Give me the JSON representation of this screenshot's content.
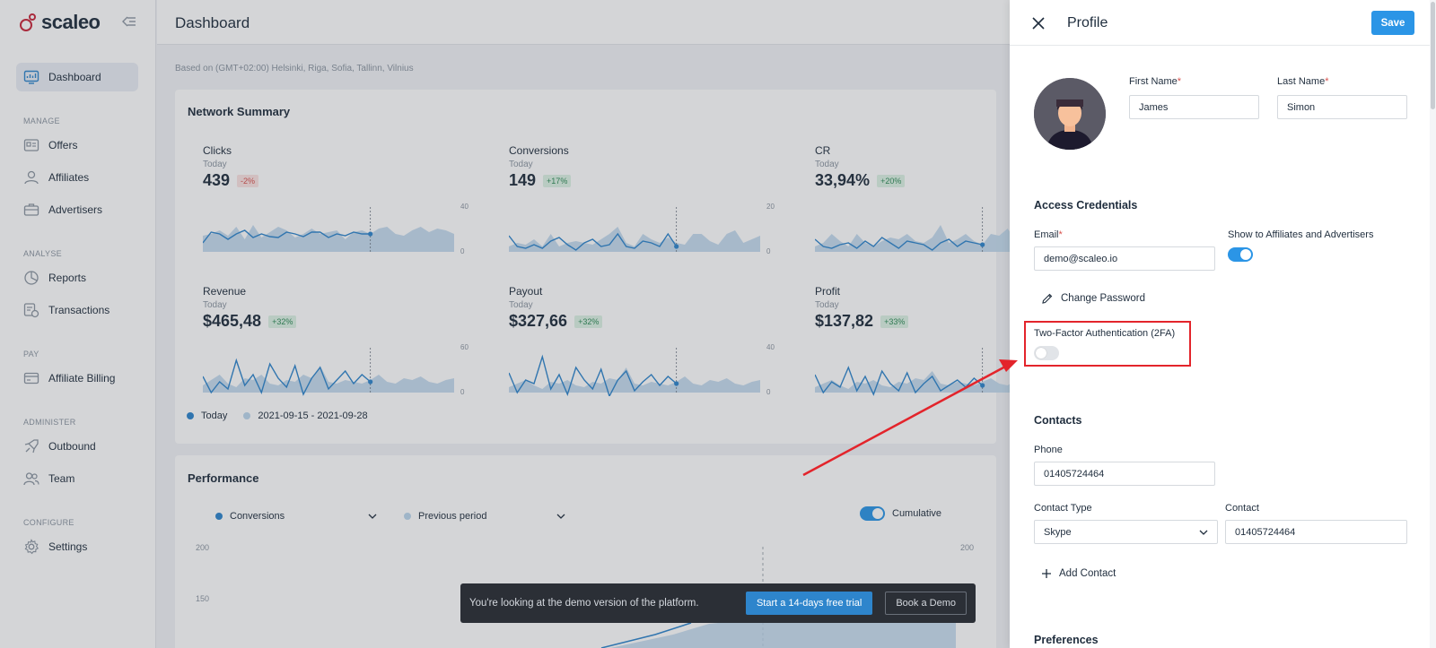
{
  "app": {
    "brand": "scaleo",
    "page_title": "Dashboard",
    "timezone_note": "Based on (GMT+02:00) Helsinki, Riga, Sofia, Tallinn, Vilnius"
  },
  "sidebar": {
    "items": [
      {
        "label": "Dashboard",
        "icon": "dashboard-icon",
        "active": true
      },
      {
        "section": "MANAGE"
      },
      {
        "label": "Offers",
        "icon": "offers-icon"
      },
      {
        "label": "Affiliates",
        "icon": "user-icon"
      },
      {
        "label": "Advertisers",
        "icon": "briefcase-icon"
      },
      {
        "section": "ANALYSE"
      },
      {
        "label": "Reports",
        "icon": "pie-chart-icon"
      },
      {
        "label": "Transactions",
        "icon": "transactions-icon"
      },
      {
        "section": "PAY"
      },
      {
        "label": "Affiliate Billing",
        "icon": "billing-icon"
      },
      {
        "section": "ADMINISTER"
      },
      {
        "label": "Outbound",
        "icon": "rocket-icon"
      },
      {
        "label": "Team",
        "icon": "team-icon"
      },
      {
        "section": "CONFIGURE"
      },
      {
        "label": "Settings",
        "icon": "gear-icon"
      }
    ],
    "labels": {
      "dashboard": "Dashboard",
      "manage": "MANAGE",
      "offers": "Offers",
      "affiliates": "Affiliates",
      "advertisers": "Advertisers",
      "analyse": "ANALYSE",
      "reports": "Reports",
      "transactions": "Transactions",
      "pay": "PAY",
      "billing": "Affiliate Billing",
      "administer": "ADMINISTER",
      "outbound": "Outbound",
      "team": "Team",
      "configure": "CONFIGURE",
      "settings": "Settings"
    }
  },
  "network_summary": {
    "title": "Network Summary",
    "metrics": [
      {
        "label": "Clicks",
        "period": "Today",
        "value": "439",
        "change": "-2%",
        "trend": "neg",
        "axis_max": "40",
        "axis_min": "0"
      },
      {
        "label": "Conversions",
        "period": "Today",
        "value": "149",
        "change": "+17%",
        "trend": "pos",
        "axis_max": "20",
        "axis_min": "0"
      },
      {
        "label": "CR",
        "period": "Today",
        "value": "33,94%",
        "change": "+20%",
        "trend": "pos",
        "axis_max": "",
        "axis_min": ""
      },
      {
        "label": "Revenue",
        "period": "Today",
        "value": "$465,48",
        "change": "+32%",
        "trend": "pos",
        "axis_max": "60",
        "axis_min": "0"
      },
      {
        "label": "Payout",
        "period": "Today",
        "value": "$327,66",
        "change": "+32%",
        "trend": "pos",
        "axis_max": "40",
        "axis_min": "0"
      },
      {
        "label": "Profit",
        "period": "Today",
        "value": "$137,82",
        "change": "+33%",
        "trend": "pos",
        "axis_max": "",
        "axis_min": ""
      }
    ],
    "legend": {
      "today": "Today",
      "range": "2021-09-15 - 2021-09-28"
    }
  },
  "performance": {
    "title": "Performance",
    "series_select": "Conversions",
    "compare_select": "Previous period",
    "cumulative_label": "Cumulative",
    "cumulative_on": true,
    "y_ticks": [
      "200",
      "150"
    ],
    "y_right_top": "200"
  },
  "demo_banner": {
    "text": "You're looking at the demo version of the platform.",
    "trial_button": "Start a 14-days free trial",
    "demo_button": "Book a Demo"
  },
  "profile": {
    "title": "Profile",
    "save_label": "Save",
    "first_name_label": "First Name",
    "first_name": "James",
    "last_name_label": "Last Name",
    "last_name": "Simon",
    "required_mark": "*",
    "access_title": "Access Credentials",
    "email_label": "Email",
    "email": "demo@scaleo.io",
    "show_label": "Show to Affiliates and Advertisers",
    "show_on": true,
    "change_password": "Change Password",
    "twofa_label": "Two-Factor Authentication (2FA)",
    "twofa_on": false,
    "contacts_title": "Contacts",
    "phone_label": "Phone",
    "phone": "01405724464",
    "contact_type_label": "Contact Type",
    "contact_type": "Skype",
    "contact_label": "Contact",
    "contact": "01405724464",
    "add_contact": "Add Contact",
    "preferences_title": "Preferences"
  },
  "colors": {
    "accent": "#2b95e6",
    "brand": "#c8263a",
    "annotation": "#e3242b",
    "spark_line": "#2e85cc",
    "spark_area": "#bcd6ec"
  }
}
